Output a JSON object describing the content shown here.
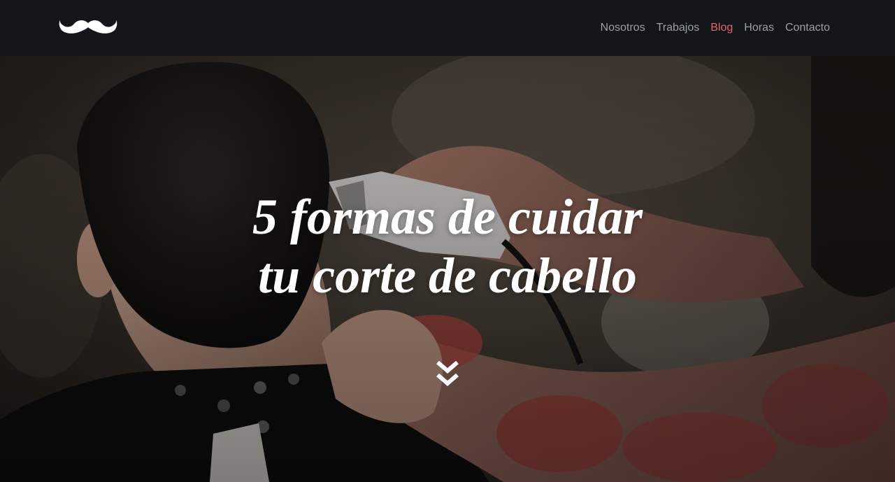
{
  "brand": {
    "logo_icon": "mustache-icon",
    "accent_color": "#e4676a"
  },
  "nav": {
    "items": [
      {
        "label": "Nosotros",
        "active": false
      },
      {
        "label": "Trabajos",
        "active": false
      },
      {
        "label": "Blog",
        "active": true
      },
      {
        "label": "Horas",
        "active": false
      },
      {
        "label": "Contacto",
        "active": false
      }
    ]
  },
  "hero": {
    "title_line1": "5 formas de cuidar",
    "title_line2": "tu corte de cabello",
    "scroll_icon": "double-chevron-down-icon",
    "background": "barber-cutting-hair-photo"
  }
}
